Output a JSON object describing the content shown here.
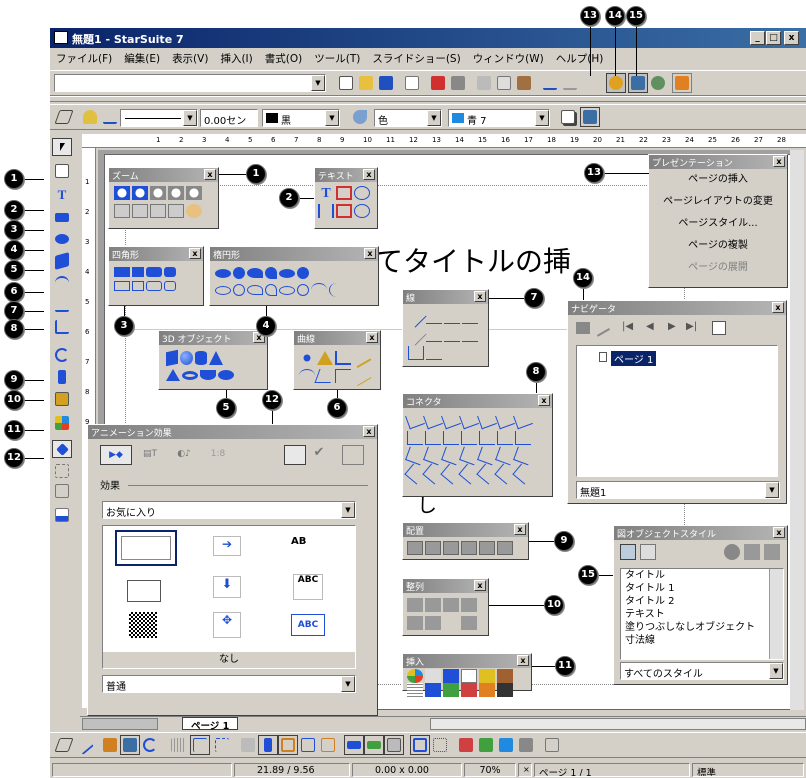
{
  "window": {
    "title": "無題1 - StarSuite 7",
    "controls": [
      "_",
      "□",
      "x"
    ]
  },
  "menu": [
    "ファイル(F)",
    "編集(E)",
    "表示(V)",
    "挿入(I)",
    "書式(O)",
    "ツール(T)",
    "スライドショー(S)",
    "ウィンドウ(W)",
    "ヘルプ(H)"
  ],
  "toolbar2": {
    "line_width": "0.00セン",
    "line_color": "黒",
    "area_style": "色",
    "area_color": "青 7"
  },
  "ruler_ticks": [
    "1",
    "2",
    "3",
    "4",
    "5",
    "6",
    "7",
    "8",
    "9",
    "10",
    "11",
    "12",
    "13",
    "14",
    "15",
    "16",
    "17",
    "18",
    "19",
    "20",
    "21",
    "22",
    "23",
    "24",
    "25",
    "26",
    "27",
    "28"
  ],
  "vruler_ticks": [
    "1",
    "2",
    "3",
    "4",
    "5",
    "6",
    "7",
    "8",
    "9"
  ],
  "slide_title_fragment": "てタイトルの挿",
  "slide_text_fragment": "し",
  "callouts": [
    "1",
    "2",
    "3",
    "4",
    "5",
    "6",
    "7",
    "8",
    "9",
    "10",
    "11",
    "12",
    "13",
    "14",
    "15"
  ],
  "panels": {
    "zoom": {
      "title": "ズーム"
    },
    "text": {
      "title": "テキスト"
    },
    "rect": {
      "title": "四角形"
    },
    "ellipse": {
      "title": "楕円形"
    },
    "obj3d": {
      "title": "3D オブジェクト"
    },
    "curve": {
      "title": "曲線"
    },
    "lines": {
      "title": "線"
    },
    "connector": {
      "title": "コネクタ"
    },
    "align": {
      "title": "配置"
    },
    "arrange": {
      "title": "整列"
    },
    "insert": {
      "title": "挿入"
    }
  },
  "presentation": {
    "title": "プレゼンテーション",
    "items": [
      "ページの挿入",
      "ページレイアウトの変更",
      "ページスタイル...",
      "ページの複製",
      "ページの展開"
    ]
  },
  "navigator": {
    "title": "ナビゲータ",
    "page": "ページ 1",
    "doc": "無題1"
  },
  "stylist": {
    "title": "図オブジェクトスタイル",
    "items": [
      "タイトル",
      "タイトル 1",
      "タイトル 2",
      "テキスト",
      "塗りつぶしなしオブジェクト",
      "寸法線"
    ],
    "filter": "すべてのスタイル"
  },
  "animation": {
    "title": "アニメーション効果",
    "tab4": "1:8",
    "section": "効果",
    "category": "お気に入り",
    "effect_none": "なし",
    "speed": "普通",
    "grid_labels": [
      "AB",
      "ABC",
      "ABC"
    ]
  },
  "page_tab": "ページ 1",
  "status": {
    "position": "21.89 / 9.56",
    "size": "0.00 x 0.00",
    "zoom": "70%",
    "page": "ページ 1 / 1",
    "layout": "標準"
  },
  "colors": {
    "accent": "#0a246a",
    "selection": "#0a246a",
    "callout": "#000000",
    "panel_title": "#808080",
    "icon_blue": "#1f4fd6"
  }
}
